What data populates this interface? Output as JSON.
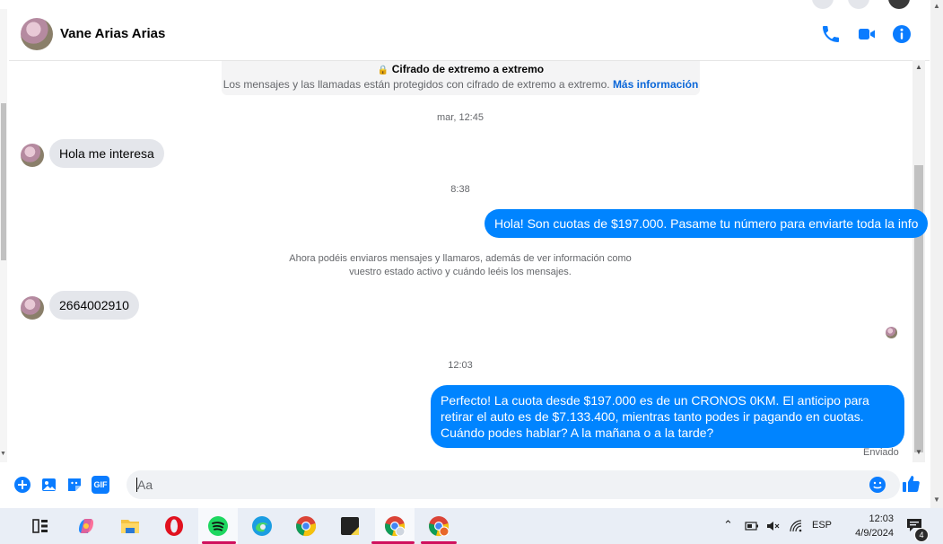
{
  "colors": {
    "accent": "#0084ff",
    "link": "#0a66d8",
    "incoming_bubble": "#e4e6eb",
    "outgoing_bubble": "#0084ff",
    "taskbar": "#e9eef6",
    "underline_active": "#d0115d"
  },
  "header": {
    "contact_name": "Vane Arias Arias",
    "icons": [
      "phone-icon",
      "video-camera-icon",
      "info-icon"
    ]
  },
  "encryption_notice": {
    "title": "Cifrado de extremo a extremo",
    "body": "Los mensajes y las llamadas están protegidos con cifrado de extremo a extremo.",
    "link": "Más información"
  },
  "messages": [
    {
      "kind": "timestamp",
      "text": "mar, 12:45"
    },
    {
      "kind": "incoming",
      "text": "Hola me interesa"
    },
    {
      "kind": "timestamp",
      "text": "8:38"
    },
    {
      "kind": "outgoing",
      "text": "Hola! Son cuotas de $197.000. Pasame tu número para enviarte toda la info"
    },
    {
      "kind": "notice",
      "text": "Ahora podéis enviaros mensajes y llamaros, además de ver información como vuestro estado activo y cuándo leéis los mensajes."
    },
    {
      "kind": "incoming",
      "text": "2664002910"
    },
    {
      "kind": "timestamp",
      "text": "12:03"
    },
    {
      "kind": "outgoing",
      "text": "Perfecto! La cuota desde $197.000 es de un CRONOS 0KM. El anticipo para retirar el auto es de $7.133.400, mientras tanto podes ir pagando en cuotas. Cuándo podes hablar? A la mañana o a la tarde?"
    }
  ],
  "status": "Enviado",
  "composer": {
    "placeholder": "Aa",
    "gif_label": "GIF",
    "icons": [
      "plus-icon",
      "image-icon",
      "sticker-icon",
      "gif-icon",
      "emoji-icon",
      "thumbs-up-icon"
    ]
  },
  "taskbar": {
    "apps": [
      "task-view-icon",
      "copilot-icon",
      "file-explorer-icon",
      "opera-icon",
      "spotify-icon",
      "edge-icon",
      "chrome-icon",
      "sticky-notes-icon",
      "chrome-profile-icon",
      "chrome-profile-2-icon"
    ],
    "tray_language": "ESP",
    "time": "12:03",
    "date": "4/9/2024",
    "notification_count": "4"
  }
}
